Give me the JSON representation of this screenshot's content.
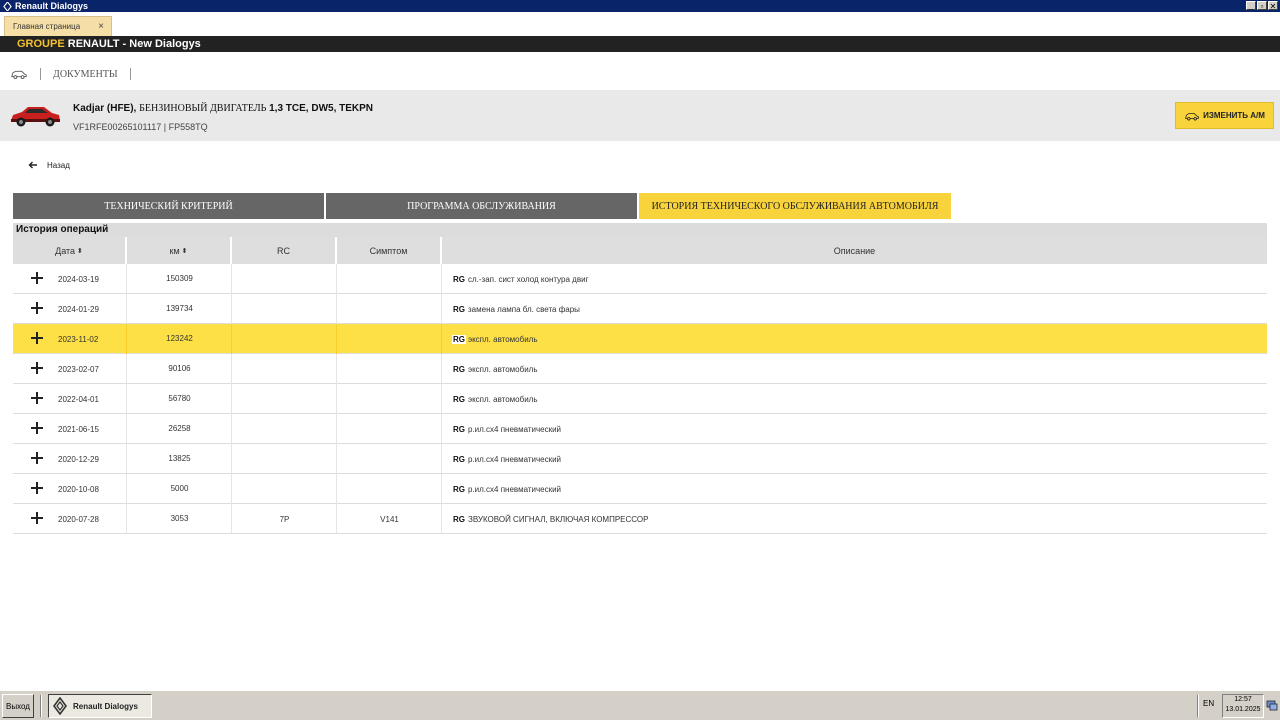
{
  "window": {
    "title": "Renault Dialogys",
    "minimize": "_",
    "restore": "▫",
    "close": "✕"
  },
  "tabs_bar": {
    "home_tab": "Главная страница",
    "close_glyph": "×"
  },
  "brand": {
    "groupe": "GROUPE",
    "renault": "RENAULT -",
    "app": "New Dialogys"
  },
  "crumbs": {
    "documents": "ДОКУМЕНТЫ"
  },
  "vehicle": {
    "model": "Kadjar (HFE),",
    "engine": "БЕНЗИНОВЫЙ ДВИГАТЕЛЬ",
    "spec": "1,3 TCE, DW5, TEKPN",
    "vin": "VF1RFE00265101117 | FP558TQ",
    "change_button": "ИЗМЕНИТЬ А/М"
  },
  "back": {
    "label": "Назад"
  },
  "main_tabs": [
    {
      "label": "ТЕХНИЧЕСКИЙ КРИТЕРИЙ"
    },
    {
      "label": "ПРОГРАММА ОБСЛУЖИВАНИЯ"
    },
    {
      "label": "ИСТОРИЯ ТЕХНИЧЕСКОГО ОБСЛУЖИВАНИЯ АВТОМОБИЛЯ"
    }
  ],
  "section": {
    "title": "История операций"
  },
  "table": {
    "headers": {
      "date": "Дата",
      "km": "км",
      "rc": "RC",
      "symptom": "Симптом",
      "description": "Описание",
      "sort": "⬍"
    },
    "rows": [
      {
        "date": "2024-03-19",
        "km": "150309",
        "rc": "",
        "symptom": "",
        "tag": "RG",
        "desc": "сл.-зап. сист холод контура двиг"
      },
      {
        "date": "2024-01-29",
        "km": "139734",
        "rc": "",
        "symptom": "",
        "tag": "RG",
        "desc": "замена лампа бл. света фары"
      },
      {
        "date": "2023-11-02",
        "km": "123242",
        "rc": "",
        "symptom": "",
        "tag": "RG",
        "desc": "экспл. автомобиль"
      },
      {
        "date": "2023-02-07",
        "km": "90106",
        "rc": "",
        "symptom": "",
        "tag": "RG",
        "desc": "экспл. автомобиль"
      },
      {
        "date": "2022-04-01",
        "km": "56780",
        "rc": "",
        "symptom": "",
        "tag": "RG",
        "desc": "экспл. автомобиль"
      },
      {
        "date": "2021-06-15",
        "km": "26258",
        "rc": "",
        "symptom": "",
        "tag": "RG",
        "desc": "р.ил.сх4 пневматический"
      },
      {
        "date": "2020-12-29",
        "km": "13825",
        "rc": "",
        "symptom": "",
        "tag": "RG",
        "desc": "р.ил.сх4 пневматический"
      },
      {
        "date": "2020-10-08",
        "km": "5000",
        "rc": "",
        "symptom": "",
        "tag": "RG",
        "desc": "р.ил.сх4 пневматический"
      },
      {
        "date": "2020-07-28",
        "km": "3053",
        "rc": "7P",
        "symptom": "V141",
        "tag": "RG",
        "desc": "ЗВУКОВОЙ СИГНАЛ, ВКЛЮЧАЯ КОМПРЕССОР"
      }
    ],
    "selected_row": 2
  },
  "taskbar": {
    "exit": "Выход",
    "app": "Renault Dialogys",
    "lang": "EN",
    "time": "12:57",
    "date": "13.01.2025"
  },
  "colors": {
    "accent": "#f8d33c",
    "selected_row": "#fde046",
    "tab_inactive": "#666666",
    "brand_bar": "#222222",
    "title_bar": "#0a246a"
  }
}
